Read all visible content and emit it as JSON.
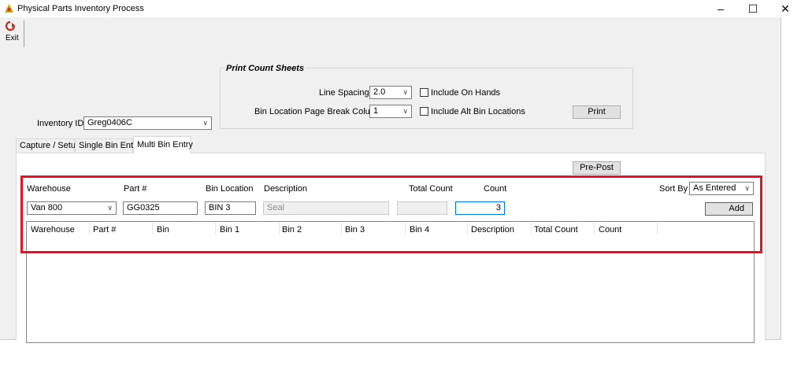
{
  "window": {
    "title": "Physical Parts Inventory Process",
    "minimize": "–",
    "maximize": "☐",
    "close": "✕"
  },
  "toolbar": {
    "exit_label": "Exit"
  },
  "inventory": {
    "label": "Inventory ID",
    "value": "Greg0406C"
  },
  "print_group": {
    "title": "Print Count Sheets",
    "line_spacing_label": "Line Spacing",
    "line_spacing_value": "2.0",
    "include_on_hands_label": "Include On Hands",
    "page_break_label": "Bin Location Page Break Column",
    "page_break_value": "1",
    "include_alt_bins_label": "Include Alt Bin Locations",
    "print_button": "Print"
  },
  "tabs": [
    {
      "label": "Capture / Setup"
    },
    {
      "label": "Single Bin Entry"
    },
    {
      "label": "Multi Bin Entry"
    }
  ],
  "multi_bin": {
    "prepost_button": "Pre-Post",
    "warehouse_label": "Warehouse",
    "part_label": "Part #",
    "bin_location_label": "Bin Location",
    "description_label": "Description",
    "total_count_label": "Total Count",
    "count_label": "Count",
    "sort_by_label": "Sort By",
    "sort_by_value": "As Entered",
    "warehouse_value": "Van 800",
    "part_value": "GG0325",
    "bin_location_value": "BIN 3",
    "description_value": "Seal",
    "total_count_value": "",
    "count_value": "3",
    "add_button": "Add",
    "grid_columns": [
      "Warehouse",
      "Part #",
      "Bin",
      "Bin 1",
      "Bin 2",
      "Bin 3",
      "Bin 4",
      "Description",
      "Total Count",
      "Count"
    ]
  },
  "colors": {
    "highlight": "#e81123",
    "focus": "#0078d7",
    "exit_icon": "#c42b1c"
  }
}
